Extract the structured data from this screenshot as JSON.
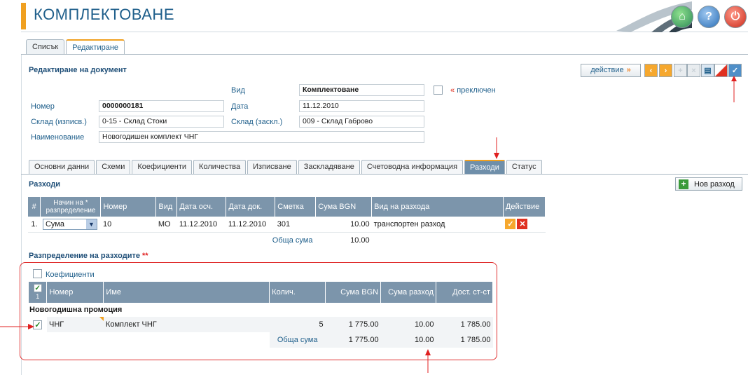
{
  "header": {
    "title": "КОМПЛЕКТОВАНЕ"
  },
  "top_tabs": [
    {
      "label": "Списък"
    },
    {
      "label": "Редактиране"
    }
  ],
  "doc": {
    "section_title": "Редактиране на документ",
    "action_label": "действие",
    "action_arrow": "»"
  },
  "form": {
    "type_label": "Вид",
    "type_value": "Комплектоване",
    "switch_label": "преключен",
    "switch_mark": "«",
    "number_label": "Номер",
    "number_value": "0000000181",
    "date_label": "Дата",
    "date_value": "11.12.2010",
    "wh_out_label": "Склад (изписв.)",
    "wh_out_value": "0-15 - Склад Стоки",
    "wh_in_label": "Склад (заскл.)",
    "wh_in_value": "009 - Склад Габрово",
    "name_label": "Наименование",
    "name_value": "Новогодишен комплект ЧНГ"
  },
  "sub_tabs": [
    {
      "label": "Основни данни"
    },
    {
      "label": "Схеми"
    },
    {
      "label": "Коефициенти"
    },
    {
      "label": "Количества"
    },
    {
      "label": "Изписване"
    },
    {
      "label": "Заскладяване"
    },
    {
      "label": "Счетоводна информация"
    },
    {
      "label": "Разходи"
    },
    {
      "label": "Статус"
    }
  ],
  "expenses": {
    "title": "Разходи",
    "new_button": "Нов разход",
    "columns": {
      "idx": "#",
      "method": "Начин на * разпределение",
      "number": "Номер",
      "type": "Вид",
      "acc_date": "Дата осч.",
      "doc_date": "Дата док.",
      "account": "Сметка",
      "sum": "Сума BGN",
      "kind": "Вид на разхода",
      "action": "Действие"
    },
    "rows": [
      {
        "idx": "1.",
        "method": "Сума",
        "number": "10",
        "type": "МО",
        "acc_date": "11.12.2010",
        "doc_date": "11.12.2010",
        "account": "301",
        "sum": "10.00",
        "kind": "транспортен разход"
      }
    ],
    "total_label": "Обща сума",
    "total_value": "10.00"
  },
  "distribution": {
    "title": "Разпределение на разходите",
    "title_mark": "**",
    "coeff_label": "Коефициенти",
    "header_count": "1",
    "columns": {
      "number": "Номер",
      "name": "Име",
      "qty": "Колич.",
      "sum": "Сума BGN",
      "exp": "Сума разход",
      "cost": "Дост. ст-ст"
    },
    "group": "Новогодишна промоция",
    "rows": [
      {
        "number": "ЧНГ",
        "name": "Комплект ЧНГ",
        "qty": "5",
        "sum": "1 775.00",
        "exp": "10.00",
        "cost": "1 785.00"
      }
    ],
    "total_label": "Обща сума",
    "total_sum": "1 775.00",
    "total_exp": "10.00",
    "total_cost": "1 785.00"
  },
  "colors": {
    "accent": "#f0a020",
    "header_blue": "#7c95ab",
    "title_blue": "#1f5f8b",
    "highlight_red": "#e03030"
  }
}
